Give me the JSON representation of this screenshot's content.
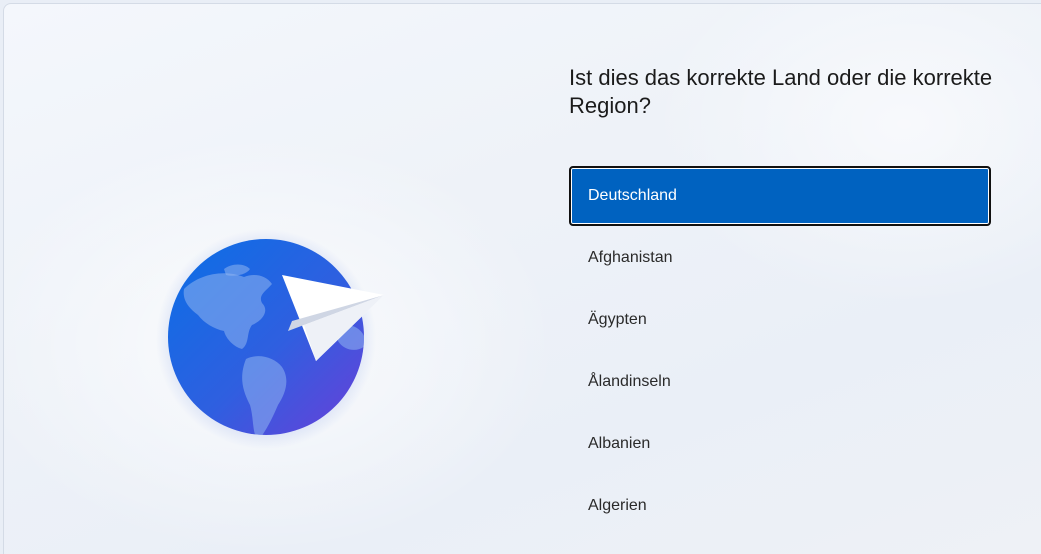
{
  "page": {
    "heading": "Ist dies das korrekte Land oder die korrekte Region?"
  },
  "country_list": {
    "selected_index": 0,
    "items": [
      {
        "label": "Deutschland"
      },
      {
        "label": "Afghanistan"
      },
      {
        "label": "Ägypten"
      },
      {
        "label": "Ålandinseln"
      },
      {
        "label": "Albanien"
      },
      {
        "label": "Algerien"
      }
    ]
  },
  "colors": {
    "selection": "#0062c0",
    "selection_border": "#111111",
    "text": "#1b1b1b"
  },
  "icons": {
    "illustration": "globe-with-paper-plane-icon"
  }
}
